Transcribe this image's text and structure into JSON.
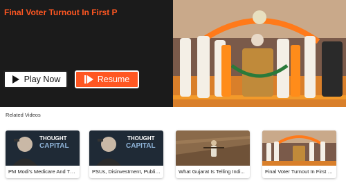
{
  "hero": {
    "title": "Final Voter Turnout In First P",
    "play_label": "Play Now",
    "resume_label": "Resume",
    "accent": "#ff5722"
  },
  "related": {
    "heading": "Related Videos",
    "items": [
      {
        "caption": "PM Modi's Medicare And The...",
        "thumb_text_1": "THOUGHT",
        "thumb_text_2": "CAPITAL"
      },
      {
        "caption": "PSUs, Disinvestment, Public...",
        "thumb_text_1": "THOUGHT",
        "thumb_text_2": "CAPITAL"
      },
      {
        "caption": "What Gujarat Is Telling Indi..."
      },
      {
        "caption": "Final Voter Turnout In First P..."
      }
    ]
  },
  "icons": {
    "play": "play-icon",
    "resume": "resume-icon"
  }
}
